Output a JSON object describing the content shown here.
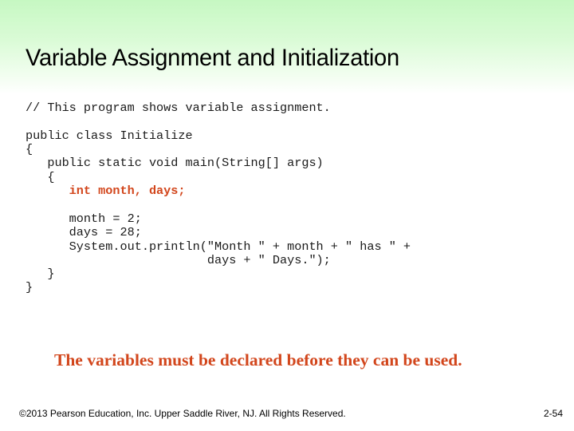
{
  "slide": {
    "title": "Variable Assignment and Initialization",
    "code_lines": [
      {
        "text": "// This program shows variable assignment.",
        "highlight": false,
        "gap_after": true
      },
      {
        "text": "public class Initialize",
        "highlight": false,
        "gap_after": false
      },
      {
        "text": "{",
        "highlight": false,
        "gap_after": false
      },
      {
        "text": "   public static void main(String[] args)",
        "highlight": false,
        "gap_after": false
      },
      {
        "text": "   {",
        "highlight": false,
        "gap_after": false
      },
      {
        "text": "      int month, days;",
        "highlight": true,
        "gap_after": true
      },
      {
        "text": "      month = 2;",
        "highlight": false,
        "gap_after": false
      },
      {
        "text": "      days = 28;",
        "highlight": false,
        "gap_after": false
      },
      {
        "text": "      System.out.println(\"Month \" + month + \" has \" +",
        "highlight": false,
        "gap_after": false
      },
      {
        "text": "                         days + \" Days.\");",
        "highlight": false,
        "gap_after": false
      },
      {
        "text": "   }",
        "highlight": false,
        "gap_after": false
      },
      {
        "text": "}",
        "highlight": false,
        "gap_after": false
      }
    ],
    "caption": "The variables must be declared before they can be used.",
    "footer": {
      "copyright": "©2013 Pearson Education, Inc. Upper Saddle River, NJ. All Rights Reserved.",
      "page_number": "2-54"
    }
  },
  "colors": {
    "background_top": "#c6f8c2",
    "background_bottom": "#ffffff",
    "highlight": "#d2461c",
    "text": "#000000"
  }
}
